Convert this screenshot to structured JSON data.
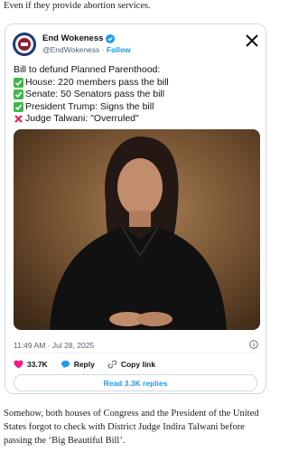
{
  "article": {
    "top_text": "Even if they provide abortion services.",
    "bottom_text": "Somehow, both houses of Congress and the President of the United States forgot to check with District Judge Indira Talwani before passing the ‘Big Beautiful Bill’."
  },
  "tweet": {
    "author_name": "End Wokeness",
    "handle": "@EndWokeness",
    "separator": "·",
    "follow_label": "Follow",
    "lines": [
      {
        "icon": "none",
        "text": "Bill to defund Planned Parenthood:"
      },
      {
        "icon": "check-mark-icon",
        "text": "House: 220 members pass the bill"
      },
      {
        "icon": "check-mark-icon",
        "text": "Senate: 50 Senators pass the bill"
      },
      {
        "icon": "check-mark-icon",
        "text": "President Trump: Signs the bill"
      },
      {
        "icon": "cross-mark-icon",
        "text": "Judge Talwani: \"Overruled\""
      }
    ],
    "timestamp": "11:49 AM · Jul 28, 2025",
    "like_count": "33.7K",
    "reply_label": "Reply",
    "copy_link_label": "Copy link",
    "read_replies_label": "Read 3.3K replies",
    "colors": {
      "accent": "#1d9bf0",
      "like": "#f91880",
      "check": "#43b649",
      "cross": "#e0245e"
    }
  }
}
